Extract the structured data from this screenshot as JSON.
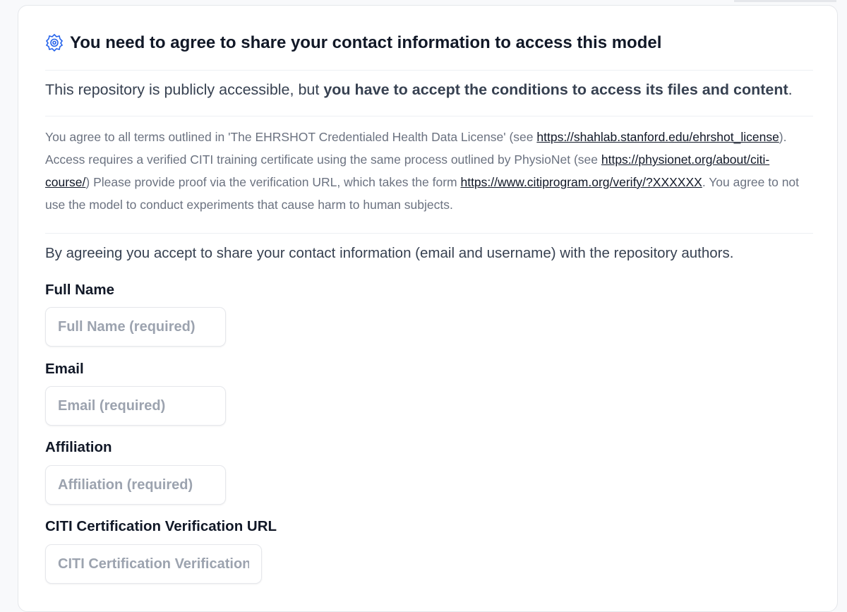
{
  "header": {
    "title": "You need to agree to share your contact information to access this model",
    "icon": "gated-repo-icon",
    "icon_color": "#2563eb"
  },
  "access": {
    "prefix": "This repository is publicly accessible, but ",
    "bold": "you have to accept the conditions to access its files and content",
    "suffix": "."
  },
  "terms": {
    "t1": "You agree to all terms outlined in 'The EHRSHOT Credentialed Health Data License' (see ",
    "link1": "https://shahlab.stanford.edu/ehrshot_license",
    "t2": "). Access requires a verified CITI training certificate using the same process outlined by PhysioNet (see ",
    "link2": "https://physionet.org/about/citi-course/",
    "t3": ") Please provide proof via the verification URL, which takes the form ",
    "link3": "https://www.citiprogram.org/verify/?XXXXXX",
    "t4": ". You agree to not use the model to conduct experiments that cause harm to human subjects."
  },
  "agreement": {
    "text": "By agreeing you accept to share your contact information (email and username) with the repository authors."
  },
  "form": {
    "fields": [
      {
        "label": "Full Name",
        "placeholder": "Full Name (required)",
        "value": ""
      },
      {
        "label": "Email",
        "placeholder": "Email (required)",
        "value": ""
      },
      {
        "label": "Affiliation",
        "placeholder": "Affiliation (required)",
        "value": ""
      },
      {
        "label": "CITI Certification Verification URL",
        "placeholder": "CITI Certification Verification",
        "value": ""
      }
    ]
  }
}
